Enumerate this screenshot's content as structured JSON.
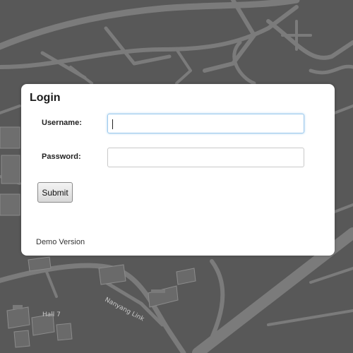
{
  "login": {
    "title": "Login",
    "username_label": "Username:",
    "username_value": "",
    "password_label": "Password:",
    "password_value": "",
    "submit_label": "Submit",
    "footer": "Demo Version"
  },
  "map": {
    "labels": [
      "Hall 7",
      "Nanyang Link"
    ]
  },
  "colors": {
    "map_background": "#5a5a5a",
    "road": "#7a7a7a",
    "dialog_background": "#ffffff",
    "focus_border": "#9ecaed"
  }
}
